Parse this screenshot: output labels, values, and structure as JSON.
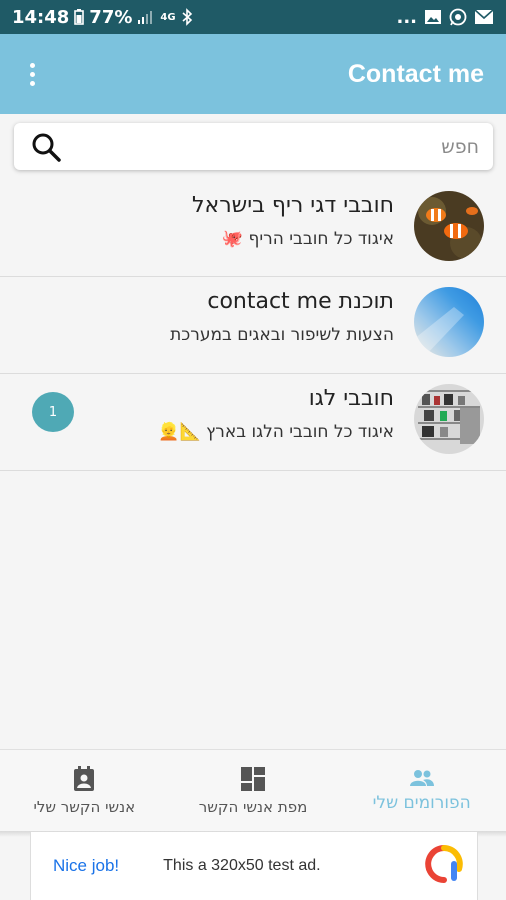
{
  "status_bar": {
    "time": "14:48",
    "battery": "77%",
    "network": "4G",
    "more": "..."
  },
  "app_bar": {
    "title": "Contact me"
  },
  "search": {
    "placeholder": "חפש"
  },
  "forums": [
    {
      "title": "חובבי דגי ריף בישראל",
      "subtitle": "איגוד כל חובבי הריף",
      "emoji": "🐙",
      "avatar": "clownfish-photo"
    },
    {
      "title": "תוכנת contact me",
      "subtitle": "הצעות לשיפור ובאגים במערכת",
      "avatar": "blue-gradient"
    },
    {
      "title": "חובבי לגו",
      "subtitle": "איגוד כל חובבי הלגו בארץ",
      "emoji": "📐👱",
      "badge": "1",
      "avatar": "lego-shelf-photo"
    }
  ],
  "bottom_nav": {
    "forums": "הפורומים שלי",
    "map": "מפת אנשי הקשר",
    "contacts": "אנשי הקשר שלי"
  },
  "ad": {
    "nice": "Nice job!",
    "text": "This a 320x50 test ad."
  },
  "colors": {
    "accent": "#7cc2dd",
    "status_bar": "#1f5a66",
    "badge": "#4fa9b5"
  }
}
